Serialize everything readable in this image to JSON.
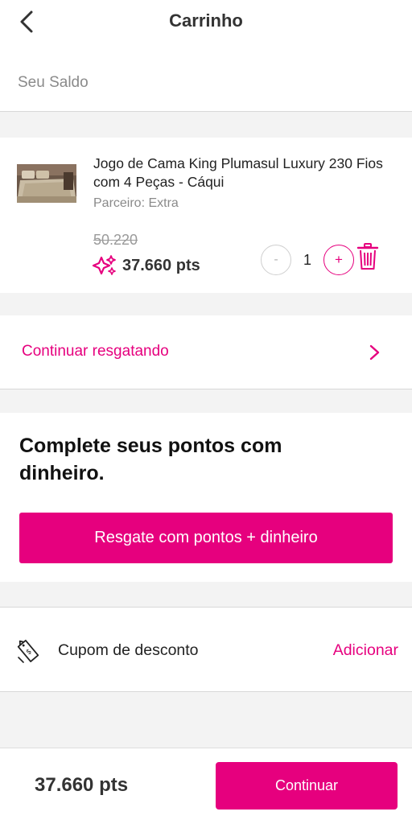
{
  "header": {
    "title": "Carrinho",
    "back_icon": "chevron-left-icon"
  },
  "balance": {
    "label": "Seu Saldo"
  },
  "cart_item": {
    "name": "Jogo de Cama King Plumasul Luxury 230 Fios com 4 Peças - Cáqui",
    "partner": "Parceiro: Extra",
    "old_price": "50.220",
    "price_points": "37.660 pts",
    "quantity": "1",
    "minus_label": "-",
    "plus_label": "+",
    "points_icon": "sparkle-points-icon",
    "trash_icon": "trash-icon"
  },
  "continue_link": {
    "label": "Continuar resgatando",
    "icon": "chevron-right-icon"
  },
  "complete_points": {
    "title": "Complete seus pontos com dinheiro.",
    "button_label": "Resgate com pontos + dinheiro"
  },
  "coupon": {
    "label": "Cupom de desconto",
    "action": "Adicionar",
    "icon": "coupon-tag-icon"
  },
  "footer": {
    "total": "37.660 pts",
    "continue_label": "Continuar"
  },
  "colors": {
    "accent": "#e6007e",
    "background": "#f3f3f3",
    "muted_text": "#8a8a8a"
  }
}
